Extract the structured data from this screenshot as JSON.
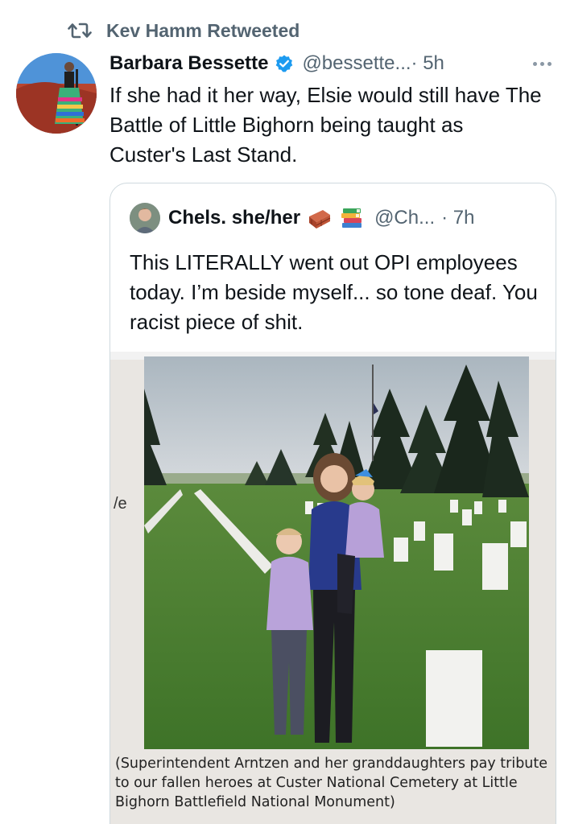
{
  "retweet": {
    "label": "Kev Hamm Retweeted",
    "icon": "retweet-icon"
  },
  "tweet": {
    "author_name": "Barbara Bessette",
    "verified": true,
    "handle": "@bessette...",
    "time": "· 5h",
    "text": "If she had it her way, Elsie would still have The Battle of Little Bighorn being taught as Custer's Last Stand."
  },
  "quoted_tweet": {
    "author_name": "Chels. she/her",
    "emojis": [
      "brick-emoji",
      "books-emoji"
    ],
    "handle": "@Ch...",
    "time": "· 7h",
    "text": "This LITERALLY went out OPI employees today. I’m beside myself... so tone deaf. You racist piece of shit.",
    "media": {
      "side_fragment": "/e",
      "caption": "(Superintendent Arntzen and her granddaughters pay tribute to our fallen heroes at Custer National Cemetery at Little Bighorn Battlefield National Monument)"
    }
  },
  "colors": {
    "text_primary": "#0f1419",
    "text_secondary": "#536471",
    "verified_blue": "#1d9bf0",
    "border": "#cfd9de"
  }
}
